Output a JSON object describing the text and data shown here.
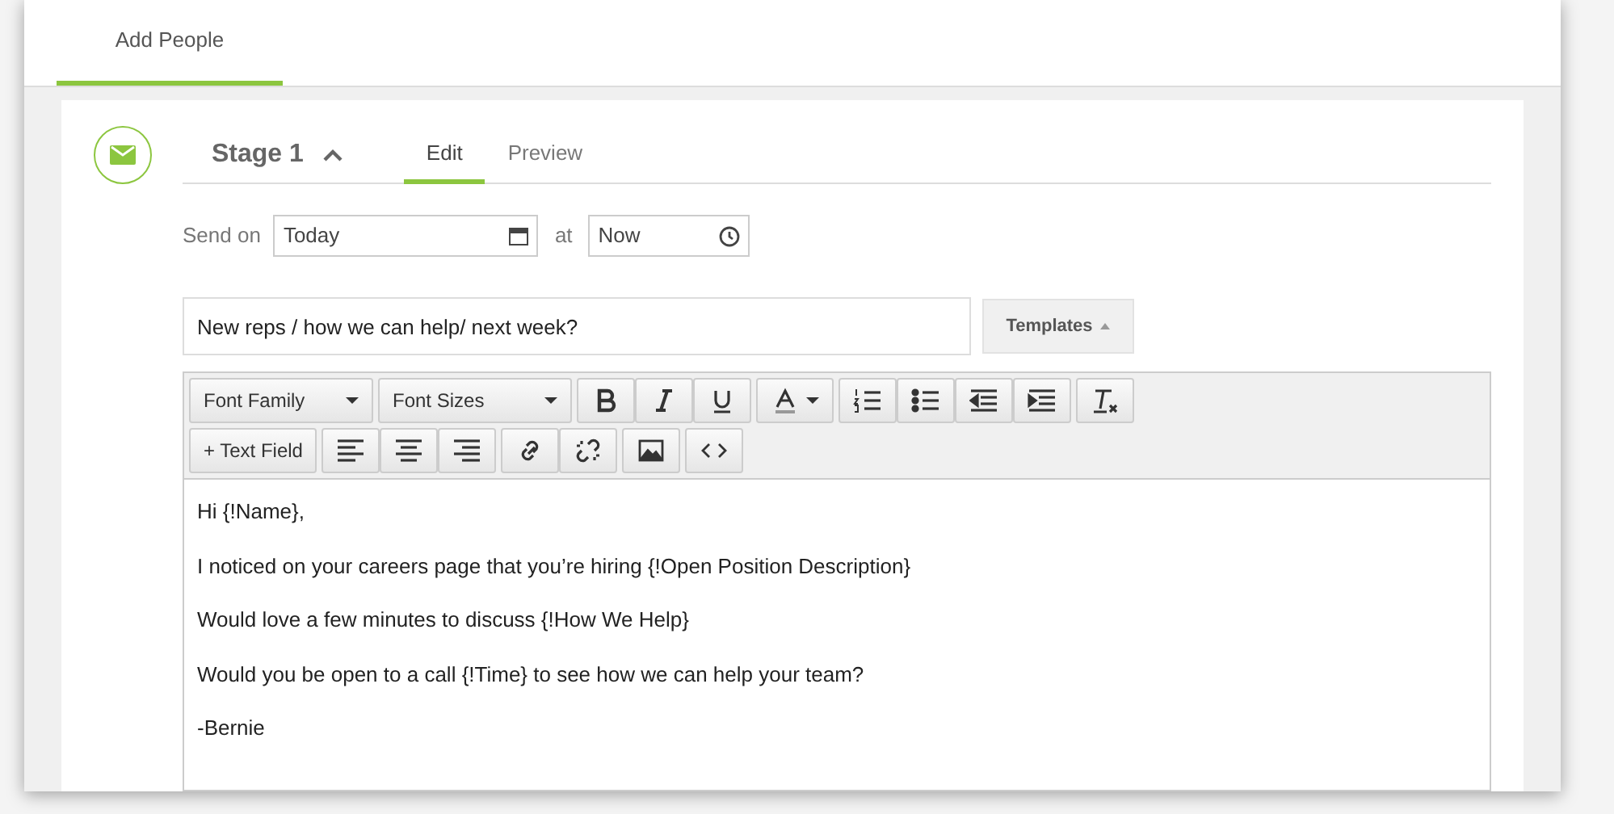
{
  "tabs": [
    {
      "label": "Add People",
      "selected": true
    }
  ],
  "stage": {
    "title": "Stage 1",
    "expanded": true,
    "tabs": [
      {
        "label": "Edit",
        "selected": true
      },
      {
        "label": "Preview",
        "selected": false
      }
    ],
    "send_on_label": "Send on",
    "date": "Today",
    "at_label": "at",
    "time": "Now",
    "subject": "New reps / how we can help/ next week?",
    "templates_button": "Templates",
    "toolbar": {
      "font_family": "Font Family",
      "font_sizes": "Font Sizes",
      "text_field": "+ Text Field"
    },
    "body": [
      "Hi {!Name},",
      "I noticed on your careers page that you’re hiring {!Open Position Description}",
      "Would love a few minutes to discuss {!How We Help}",
      "Would you be open to a call {!Time} to see how we can help your team?",
      "-Bernie"
    ]
  }
}
